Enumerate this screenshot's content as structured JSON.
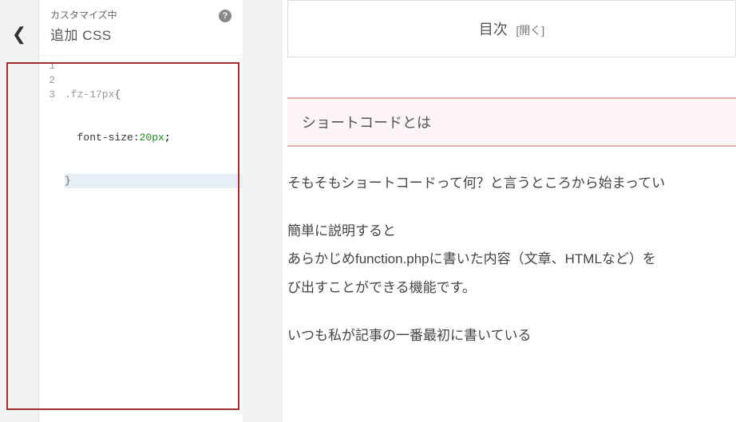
{
  "sidebar": {
    "subtitle": "カスタマイズ中",
    "title": "追加 CSS",
    "help": "?"
  },
  "code": {
    "lines": [
      "1",
      "2",
      "3"
    ],
    "l1_sel": ".fz-17px",
    "l1_brace": "{",
    "l2_indent": "  ",
    "l2_prop": "font-size:",
    "l2_num": "20px",
    "l2_semi": ";",
    "l3_brace": "}"
  },
  "preview": {
    "toc_title": "目次",
    "toc_toggle": "[開く]",
    "section_title": "ショートコードとは",
    "p1": "そもそもショートコードって何？と言うところから始まってい",
    "p2a": "簡単に説明すると",
    "p2b": "あらかじめfunction.phpに書いた内容（文章、HTMLなど）を",
    "p2c": "び出すことができる機能です。",
    "p3": "いつも私が記事の一番最初に書いている"
  }
}
